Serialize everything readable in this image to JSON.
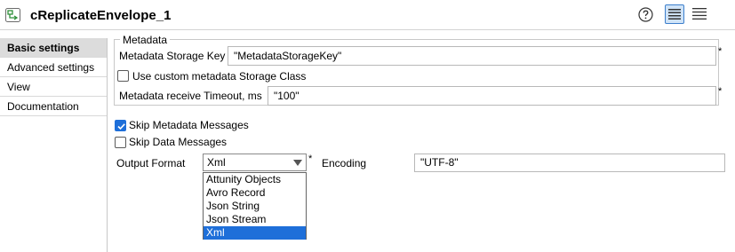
{
  "header": {
    "title": "cReplicateEnvelope_1",
    "component_icon": "component-arrow-icon",
    "help_icon": "help-icon"
  },
  "sidebar": {
    "items": [
      {
        "label": "Basic settings",
        "active": true
      },
      {
        "label": "Advanced settings",
        "active": false
      },
      {
        "label": "View",
        "active": false
      },
      {
        "label": "Documentation",
        "active": false
      }
    ]
  },
  "metadata": {
    "group_title": "Metadata",
    "storage_key_label": "Metadata Storage Key",
    "storage_key_value": "\"MetadataStorageKey\"",
    "custom_class_label": "Use custom metadata Storage Class",
    "custom_class_checked": false,
    "timeout_label": "Metadata receive Timeout, ms",
    "timeout_value": "\"100\""
  },
  "options": {
    "skip_metadata_label": "Skip Metadata Messages",
    "skip_metadata_checked": true,
    "skip_data_label": "Skip Data Messages",
    "skip_data_checked": false,
    "output_format_label": "Output Format",
    "output_format_value": "Xml",
    "output_format_options": [
      "Attunity Objects",
      "Avro Record",
      "Json String",
      "Json Stream",
      "Xml"
    ],
    "encoding_label": "Encoding",
    "encoding_value": "\"UTF-8\"",
    "required_marker": "*"
  },
  "colors": {
    "accent": "#1e6fd9",
    "active_tab_bg": "#dcdcdc",
    "view_button_bg": "#cfe3f7"
  }
}
